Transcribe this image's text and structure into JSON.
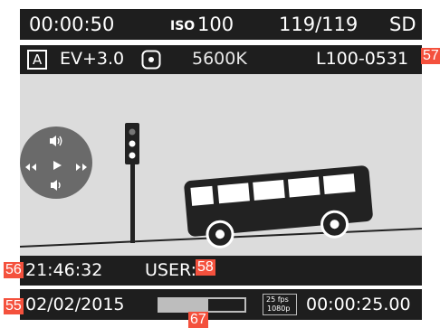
{
  "top_bar": {
    "elapsed_time": "00:00:50",
    "iso_label": "ISO",
    "iso_value": "100",
    "shots_remaining": "119/119",
    "storage": "SD"
  },
  "second_bar": {
    "exposure_mode": "A",
    "ev_compensation": "EV+3.0",
    "metering_icon": "spot-metering-icon",
    "white_balance": "5600K",
    "file_number": "L100-0531"
  },
  "playback_controls": {
    "icons": [
      "volume-up-icon",
      "rewind-icon",
      "play-icon",
      "fast-forward-icon",
      "volume-down-icon"
    ]
  },
  "bottom_info": {
    "time": "21:46:32",
    "user_label": "USER:",
    "date": "02/02/2015",
    "progress": 0.57,
    "video_format_top": "25 fps",
    "video_format_bottom": "1080p",
    "duration": "00:00:25.00"
  },
  "callouts": {
    "c57": "57",
    "c56": "56",
    "c58": "58",
    "c55": "55",
    "c67": "67"
  },
  "colors": {
    "bar_background": "#1e1e1e",
    "scene_background": "#dcdcdc",
    "callout": "#f4513d",
    "progress": "#bdbdbd"
  }
}
